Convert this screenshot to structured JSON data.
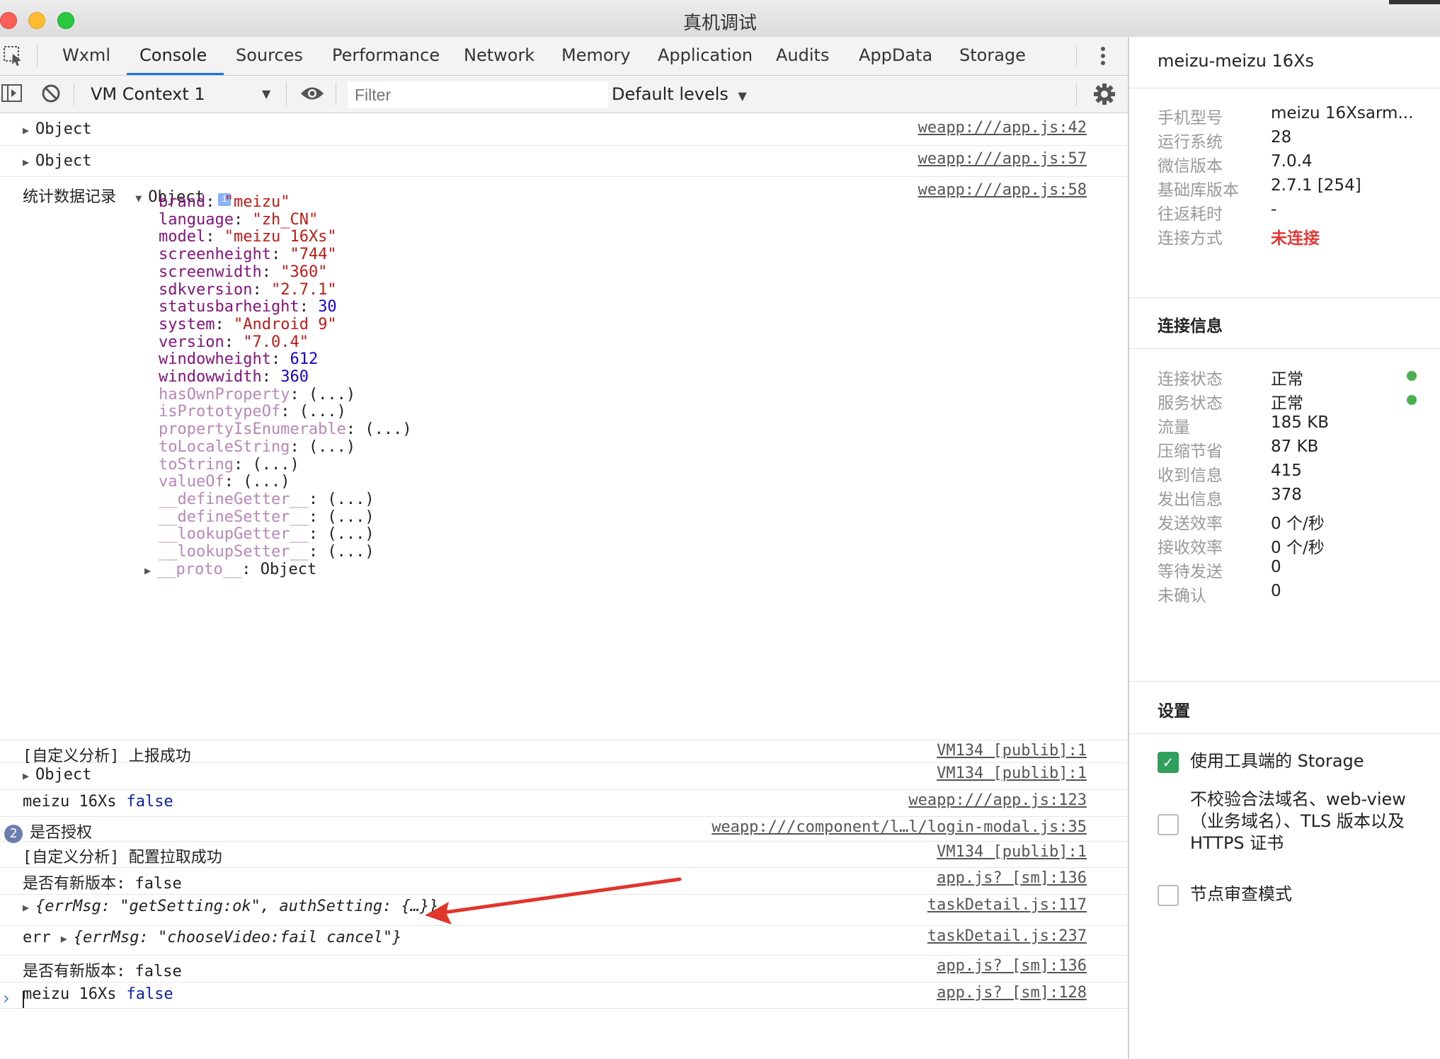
{
  "window": {
    "title": "真机调试",
    "traffic_colors": {
      "close": "#fc5f57",
      "minimize": "#febc2e",
      "zoom": "#28c840"
    }
  },
  "tabs": [
    "Wxml",
    "Console",
    "Sources",
    "Performance",
    "Network",
    "Memory",
    "Application",
    "Audits",
    "AppData",
    "Storage"
  ],
  "active_tab": "Console",
  "toolbar": {
    "context": "VM Context 1",
    "filter_placeholder": "Filter",
    "levels": "Default levels"
  },
  "console": {
    "rows": [
      {
        "prefix": "",
        "text": "Object",
        "source": "weapp:///app.js:42"
      },
      {
        "prefix": "",
        "text": "Object",
        "source": "weapp:///app.js:57"
      },
      {
        "prefix": "统计数据记录",
        "text": "Object",
        "source": "weapp:///app.js:58"
      }
    ],
    "object_props": [
      {
        "k": "brand",
        "v": "\"meizu\"",
        "t": "str"
      },
      {
        "k": "language",
        "v": "\"zh_CN\"",
        "t": "str"
      },
      {
        "k": "model",
        "v": "\"meizu 16Xs\"",
        "t": "str"
      },
      {
        "k": "screenheight",
        "v": "\"744\"",
        "t": "str"
      },
      {
        "k": "screenwidth",
        "v": "\"360\"",
        "t": "str"
      },
      {
        "k": "sdkversion",
        "v": "\"2.7.1\"",
        "t": "str"
      },
      {
        "k": "statusbarheight",
        "v": "30",
        "t": "num"
      },
      {
        "k": "system",
        "v": "\"Android 9\"",
        "t": "str"
      },
      {
        "k": "version",
        "v": "\"7.0.4\"",
        "t": "str"
      },
      {
        "k": "windowheight",
        "v": "612",
        "t": "num"
      },
      {
        "k": "windowwidth",
        "v": "360",
        "t": "num"
      },
      {
        "k": "hasOwnProperty",
        "v": "(...)",
        "t": "dim"
      },
      {
        "k": "isPrototypeOf",
        "v": "(...)",
        "t": "dim"
      },
      {
        "k": "propertyIsEnumerable",
        "v": "(...)",
        "t": "dim"
      },
      {
        "k": "toLocaleString",
        "v": "(...)",
        "t": "dim"
      },
      {
        "k": "toString",
        "v": "(...)",
        "t": "dim"
      },
      {
        "k": "valueOf",
        "v": "(...)",
        "t": "dim"
      },
      {
        "k": "__defineGetter__",
        "v": "(...)",
        "t": "dim"
      },
      {
        "k": "__defineSetter__",
        "v": "(...)",
        "t": "dim"
      },
      {
        "k": "__lookupGetter__",
        "v": "(...)",
        "t": "dim"
      },
      {
        "k": "__lookupSetter__",
        "v": "(...)",
        "t": "dim"
      },
      {
        "k": "__proto__",
        "v": "Object",
        "t": "proto"
      }
    ],
    "later": [
      {
        "text": "[自定义分析] 上报成功",
        "source": "VM134 [publib]:1"
      },
      {
        "text": "Object",
        "source": "VM134 [publib]:1"
      },
      {
        "text": "meizu 16Xs",
        "extra": "false",
        "source": "weapp:///app.js:123"
      },
      {
        "text": "是否授权",
        "badge": "2",
        "source": "weapp:///component/l…l/login-modal.js:35"
      },
      {
        "text": "[自定义分析] 配置拉取成功",
        "source": "VM134 [publib]:1"
      },
      {
        "text": "是否有新版本: false",
        "source": "app.js? [sm]:136"
      },
      {
        "text": "{errMsg: \"getSetting:ok\", authSetting: {…}}",
        "source": "taskDetail.js:117"
      },
      {
        "text": "err",
        "obj": "{errMsg: \"chooseVideo:fail cancel\"}",
        "source": "taskDetail.js:237"
      },
      {
        "text": "是否有新版本: false",
        "source": "app.js? [sm]:136"
      },
      {
        "text": "meizu 16Xs",
        "extra": "false",
        "source": "app.js? [sm]:128"
      }
    ]
  },
  "panel": {
    "device": "meizu-meizu 16Xs",
    "info": [
      {
        "label": "手机型号",
        "value": "meizu 16Xsarm..."
      },
      {
        "label": "运行系统",
        "value": "28"
      },
      {
        "label": "微信版本",
        "value": "7.0.4"
      },
      {
        "label": "基础库版本",
        "value": "2.7.1 [254]"
      },
      {
        "label": "往返耗时",
        "value": "-"
      },
      {
        "label": "连接方式",
        "value": "未连接"
      }
    ],
    "conn_title": "连接信息",
    "conn": [
      {
        "label": "连接状态",
        "value": "正常"
      },
      {
        "label": "服务状态",
        "value": "正常"
      },
      {
        "label": "流量",
        "value": "185 KB"
      },
      {
        "label": "压缩节省",
        "value": "87 KB"
      },
      {
        "label": "收到信息",
        "value": "415"
      },
      {
        "label": "发出信息",
        "value": "378"
      },
      {
        "label": "发送效率",
        "value": "0 个/秒"
      },
      {
        "label": "接收效率",
        "value": "0 个/秒"
      },
      {
        "label": "等待发送",
        "value": "0"
      },
      {
        "label": "未确认",
        "value": "0"
      }
    ],
    "settings_title": "设置",
    "settings": [
      {
        "label": "使用工具端的 Storage",
        "checked": true
      },
      {
        "label": "不校验合法域名、web-view（业务域名）、TLS 版本以及 HTTPS 证书",
        "checked": false
      },
      {
        "label": "节点审查模式",
        "checked": false
      }
    ],
    "status_color_ok": "#4caf50",
    "status_color_err": "#e53935"
  }
}
